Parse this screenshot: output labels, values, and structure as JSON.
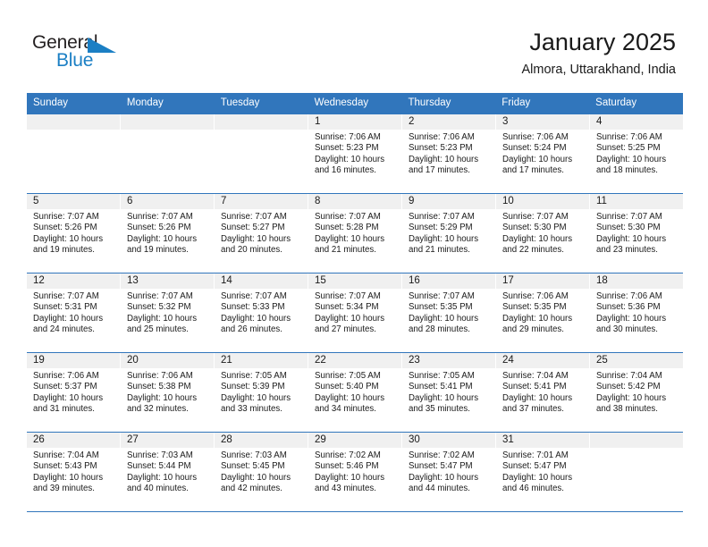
{
  "logo": {
    "word1": "General",
    "word2": "Blue",
    "accent_color": "#1b7fc4",
    "triangle_icon": "triangle-icon"
  },
  "header": {
    "title": "January 2025",
    "subtitle": "Almora, Uttarakhand, India"
  },
  "theme": {
    "header_blue": "#3176bc",
    "daynum_gray": "#f0f0f0",
    "text": "#1a1a1a"
  },
  "weekdays": [
    "Sunday",
    "Monday",
    "Tuesday",
    "Wednesday",
    "Thursday",
    "Friday",
    "Saturday"
  ],
  "weeks": [
    [
      {
        "day": "",
        "empty": true,
        "sunrise": "",
        "sunset": "",
        "daylight1": "",
        "daylight2": ""
      },
      {
        "day": "",
        "empty": true,
        "sunrise": "",
        "sunset": "",
        "daylight1": "",
        "daylight2": ""
      },
      {
        "day": "",
        "empty": true,
        "sunrise": "",
        "sunset": "",
        "daylight1": "",
        "daylight2": ""
      },
      {
        "day": "1",
        "empty": false,
        "sunrise": "Sunrise: 7:06 AM",
        "sunset": "Sunset: 5:23 PM",
        "daylight1": "Daylight: 10 hours",
        "daylight2": "and 16 minutes."
      },
      {
        "day": "2",
        "empty": false,
        "sunrise": "Sunrise: 7:06 AM",
        "sunset": "Sunset: 5:23 PM",
        "daylight1": "Daylight: 10 hours",
        "daylight2": "and 17 minutes."
      },
      {
        "day": "3",
        "empty": false,
        "sunrise": "Sunrise: 7:06 AM",
        "sunset": "Sunset: 5:24 PM",
        "daylight1": "Daylight: 10 hours",
        "daylight2": "and 17 minutes."
      },
      {
        "day": "4",
        "empty": false,
        "sunrise": "Sunrise: 7:06 AM",
        "sunset": "Sunset: 5:25 PM",
        "daylight1": "Daylight: 10 hours",
        "daylight2": "and 18 minutes."
      }
    ],
    [
      {
        "day": "5",
        "empty": false,
        "sunrise": "Sunrise: 7:07 AM",
        "sunset": "Sunset: 5:26 PM",
        "daylight1": "Daylight: 10 hours",
        "daylight2": "and 19 minutes."
      },
      {
        "day": "6",
        "empty": false,
        "sunrise": "Sunrise: 7:07 AM",
        "sunset": "Sunset: 5:26 PM",
        "daylight1": "Daylight: 10 hours",
        "daylight2": "and 19 minutes."
      },
      {
        "day": "7",
        "empty": false,
        "sunrise": "Sunrise: 7:07 AM",
        "sunset": "Sunset: 5:27 PM",
        "daylight1": "Daylight: 10 hours",
        "daylight2": "and 20 minutes."
      },
      {
        "day": "8",
        "empty": false,
        "sunrise": "Sunrise: 7:07 AM",
        "sunset": "Sunset: 5:28 PM",
        "daylight1": "Daylight: 10 hours",
        "daylight2": "and 21 minutes."
      },
      {
        "day": "9",
        "empty": false,
        "sunrise": "Sunrise: 7:07 AM",
        "sunset": "Sunset: 5:29 PM",
        "daylight1": "Daylight: 10 hours",
        "daylight2": "and 21 minutes."
      },
      {
        "day": "10",
        "empty": false,
        "sunrise": "Sunrise: 7:07 AM",
        "sunset": "Sunset: 5:30 PM",
        "daylight1": "Daylight: 10 hours",
        "daylight2": "and 22 minutes."
      },
      {
        "day": "11",
        "empty": false,
        "sunrise": "Sunrise: 7:07 AM",
        "sunset": "Sunset: 5:30 PM",
        "daylight1": "Daylight: 10 hours",
        "daylight2": "and 23 minutes."
      }
    ],
    [
      {
        "day": "12",
        "empty": false,
        "sunrise": "Sunrise: 7:07 AM",
        "sunset": "Sunset: 5:31 PM",
        "daylight1": "Daylight: 10 hours",
        "daylight2": "and 24 minutes."
      },
      {
        "day": "13",
        "empty": false,
        "sunrise": "Sunrise: 7:07 AM",
        "sunset": "Sunset: 5:32 PM",
        "daylight1": "Daylight: 10 hours",
        "daylight2": "and 25 minutes."
      },
      {
        "day": "14",
        "empty": false,
        "sunrise": "Sunrise: 7:07 AM",
        "sunset": "Sunset: 5:33 PM",
        "daylight1": "Daylight: 10 hours",
        "daylight2": "and 26 minutes."
      },
      {
        "day": "15",
        "empty": false,
        "sunrise": "Sunrise: 7:07 AM",
        "sunset": "Sunset: 5:34 PM",
        "daylight1": "Daylight: 10 hours",
        "daylight2": "and 27 minutes."
      },
      {
        "day": "16",
        "empty": false,
        "sunrise": "Sunrise: 7:07 AM",
        "sunset": "Sunset: 5:35 PM",
        "daylight1": "Daylight: 10 hours",
        "daylight2": "and 28 minutes."
      },
      {
        "day": "17",
        "empty": false,
        "sunrise": "Sunrise: 7:06 AM",
        "sunset": "Sunset: 5:35 PM",
        "daylight1": "Daylight: 10 hours",
        "daylight2": "and 29 minutes."
      },
      {
        "day": "18",
        "empty": false,
        "sunrise": "Sunrise: 7:06 AM",
        "sunset": "Sunset: 5:36 PM",
        "daylight1": "Daylight: 10 hours",
        "daylight2": "and 30 minutes."
      }
    ],
    [
      {
        "day": "19",
        "empty": false,
        "sunrise": "Sunrise: 7:06 AM",
        "sunset": "Sunset: 5:37 PM",
        "daylight1": "Daylight: 10 hours",
        "daylight2": "and 31 minutes."
      },
      {
        "day": "20",
        "empty": false,
        "sunrise": "Sunrise: 7:06 AM",
        "sunset": "Sunset: 5:38 PM",
        "daylight1": "Daylight: 10 hours",
        "daylight2": "and 32 minutes."
      },
      {
        "day": "21",
        "empty": false,
        "sunrise": "Sunrise: 7:05 AM",
        "sunset": "Sunset: 5:39 PM",
        "daylight1": "Daylight: 10 hours",
        "daylight2": "and 33 minutes."
      },
      {
        "day": "22",
        "empty": false,
        "sunrise": "Sunrise: 7:05 AM",
        "sunset": "Sunset: 5:40 PM",
        "daylight1": "Daylight: 10 hours",
        "daylight2": "and 34 minutes."
      },
      {
        "day": "23",
        "empty": false,
        "sunrise": "Sunrise: 7:05 AM",
        "sunset": "Sunset: 5:41 PM",
        "daylight1": "Daylight: 10 hours",
        "daylight2": "and 35 minutes."
      },
      {
        "day": "24",
        "empty": false,
        "sunrise": "Sunrise: 7:04 AM",
        "sunset": "Sunset: 5:41 PM",
        "daylight1": "Daylight: 10 hours",
        "daylight2": "and 37 minutes."
      },
      {
        "day": "25",
        "empty": false,
        "sunrise": "Sunrise: 7:04 AM",
        "sunset": "Sunset: 5:42 PM",
        "daylight1": "Daylight: 10 hours",
        "daylight2": "and 38 minutes."
      }
    ],
    [
      {
        "day": "26",
        "empty": false,
        "sunrise": "Sunrise: 7:04 AM",
        "sunset": "Sunset: 5:43 PM",
        "daylight1": "Daylight: 10 hours",
        "daylight2": "and 39 minutes."
      },
      {
        "day": "27",
        "empty": false,
        "sunrise": "Sunrise: 7:03 AM",
        "sunset": "Sunset: 5:44 PM",
        "daylight1": "Daylight: 10 hours",
        "daylight2": "and 40 minutes."
      },
      {
        "day": "28",
        "empty": false,
        "sunrise": "Sunrise: 7:03 AM",
        "sunset": "Sunset: 5:45 PM",
        "daylight1": "Daylight: 10 hours",
        "daylight2": "and 42 minutes."
      },
      {
        "day": "29",
        "empty": false,
        "sunrise": "Sunrise: 7:02 AM",
        "sunset": "Sunset: 5:46 PM",
        "daylight1": "Daylight: 10 hours",
        "daylight2": "and 43 minutes."
      },
      {
        "day": "30",
        "empty": false,
        "sunrise": "Sunrise: 7:02 AM",
        "sunset": "Sunset: 5:47 PM",
        "daylight1": "Daylight: 10 hours",
        "daylight2": "and 44 minutes."
      },
      {
        "day": "31",
        "empty": false,
        "sunrise": "Sunrise: 7:01 AM",
        "sunset": "Sunset: 5:47 PM",
        "daylight1": "Daylight: 10 hours",
        "daylight2": "and 46 minutes."
      },
      {
        "day": "",
        "empty": true,
        "sunrise": "",
        "sunset": "",
        "daylight1": "",
        "daylight2": ""
      }
    ]
  ]
}
